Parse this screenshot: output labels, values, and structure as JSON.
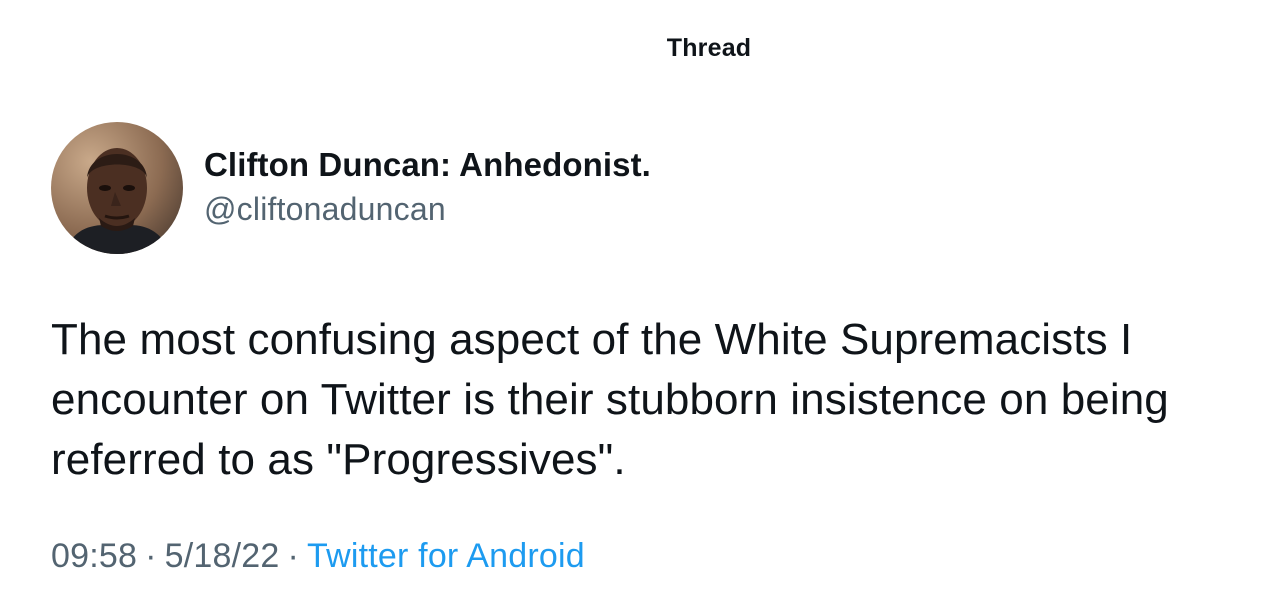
{
  "header": {
    "title": "Thread"
  },
  "author": {
    "display_name": "Clifton Duncan: Anhedonist.",
    "handle": "@cliftonaduncan",
    "avatar_icon": "profile-photo"
  },
  "tweet": {
    "text": "The most confusing aspect of the White Supremacists I encounter on Twitter is their stubborn insistence on being referred to as \"Progressives\".",
    "time": "09:58",
    "date": "5/18/22",
    "separator": "·",
    "source": "Twitter for Android"
  },
  "colors": {
    "text_primary": "#0f1419",
    "text_secondary": "#536471",
    "link": "#1d9bf0",
    "background": "#ffffff"
  }
}
